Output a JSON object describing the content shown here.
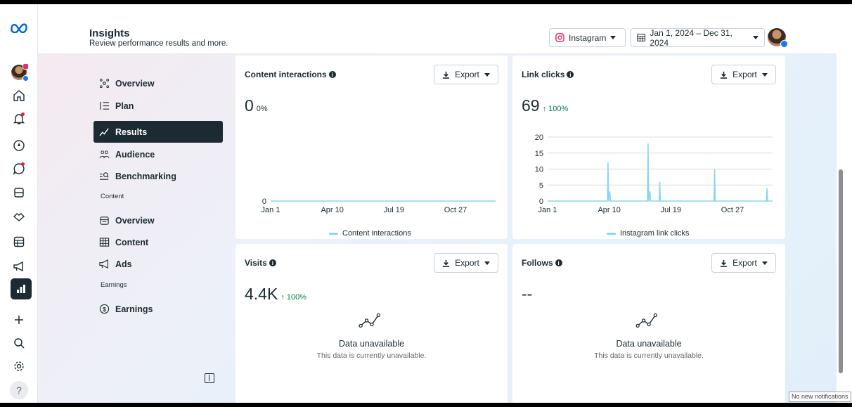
{
  "header": {
    "title": "Insights",
    "subtitle": "Review performance results and more.",
    "platform": "Instagram",
    "date_range": "Jan 1, 2024 – Dec 31, 2024"
  },
  "nav": {
    "items": [
      {
        "label": "Overview",
        "icon": "nodes-icon"
      },
      {
        "label": "Plan",
        "icon": "list-icon"
      },
      {
        "label": "Results",
        "icon": "trend-icon",
        "active": true
      },
      {
        "label": "Audience",
        "icon": "people-icon"
      },
      {
        "label": "Benchmarking",
        "icon": "compare-icon"
      }
    ],
    "content_section": "Content",
    "content_items": [
      {
        "label": "Overview",
        "icon": "media-icon"
      },
      {
        "label": "Content",
        "icon": "grid-icon"
      },
      {
        "label": "Ads",
        "icon": "megaphone-icon"
      }
    ],
    "earnings_section": "Earnings",
    "earnings_items": [
      {
        "label": "Earnings",
        "icon": "dollar-icon"
      }
    ]
  },
  "cards": {
    "content_interactions": {
      "title": "Content interactions",
      "export": "Export",
      "value": "0",
      "delta": "0%",
      "legend": "Content interactions"
    },
    "link_clicks": {
      "title": "Link clicks",
      "export": "Export",
      "value": "69",
      "delta": "↑ 100%",
      "legend": "Instagram link clicks"
    },
    "visits": {
      "title": "Visits",
      "export": "Export",
      "value": "4.4K",
      "delta": "↑ 100%",
      "unavailable_title": "Data unavailable",
      "unavailable_text": "This data is currently unavailable."
    },
    "follows": {
      "title": "Follows",
      "export": "Export",
      "value": "--",
      "unavailable_title": "Data unavailable",
      "unavailable_text": "This data is currently unavailable."
    }
  },
  "chart_data": [
    {
      "type": "line",
      "title": "Content interactions",
      "x_ticks": [
        "Jan 1",
        "Apr 10",
        "Jul 19",
        "Oct 27"
      ],
      "y_ticks": [
        0
      ],
      "ylim": [
        0,
        1
      ],
      "series": [
        {
          "name": "Content interactions",
          "values": [
            0,
            0
          ]
        }
      ]
    },
    {
      "type": "line",
      "title": "Link clicks",
      "x_ticks": [
        "Jan 1",
        "Apr 10",
        "Jul 19",
        "Oct 27"
      ],
      "y_ticks": [
        0,
        5,
        10,
        15,
        20
      ],
      "ylim": [
        0,
        20
      ],
      "series": [
        {
          "name": "Instagram link clicks",
          "points": [
            [
              0,
              0
            ],
            [
              97,
              0
            ],
            [
              98,
              12
            ],
            [
              99,
              0
            ],
            [
              101,
              3
            ],
            [
              102,
              0
            ],
            [
              162,
              0
            ],
            [
              163,
              18
            ],
            [
              164,
              0
            ],
            [
              166,
              3
            ],
            [
              167,
              0
            ],
            [
              181,
              0
            ],
            [
              182,
              6
            ],
            [
              183,
              0
            ],
            [
              270,
              0
            ],
            [
              271,
              10
            ],
            [
              272,
              0
            ],
            [
              355,
              0
            ],
            [
              356,
              4
            ],
            [
              357,
              0
            ],
            [
              365,
              0
            ]
          ]
        }
      ]
    }
  ],
  "notification": "No new notifications"
}
